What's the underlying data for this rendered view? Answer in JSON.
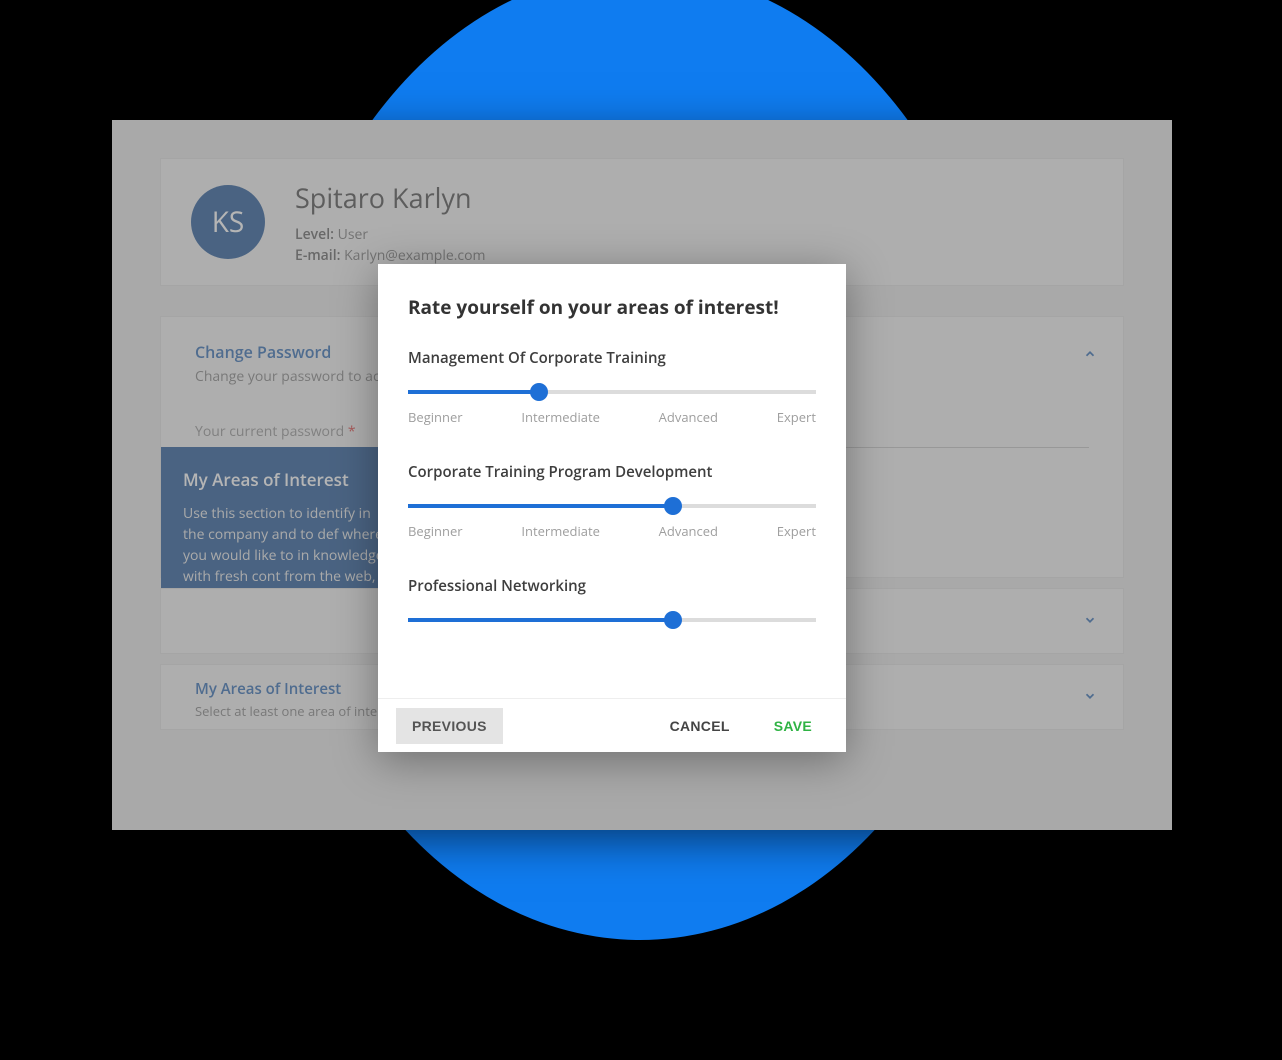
{
  "user": {
    "initials": "KS",
    "name": "Spitaro Karlyn",
    "level_label": "Level:",
    "level_value": "User",
    "email_label": "E-mail:",
    "email_value": "Karlyn@example.com"
  },
  "password_section": {
    "title": "Change Password",
    "subtitle": "Change your password to access",
    "current_label": "Your current password",
    "required_mark": "*"
  },
  "tooltip": {
    "title": "My Areas of Interest",
    "body": "Use this section to identify in the company and to def where you would like to in knowledge with fresh cont from the web, prepared fo day."
  },
  "rows": [
    {
      "title": "",
      "sub": ""
    },
    {
      "title": "My Areas of Interest",
      "sub": "Select at least one area of interest"
    }
  ],
  "modal": {
    "title": "Rate yourself on your areas of interest!",
    "ticks": [
      "Beginner",
      "Intermediate",
      "Advanced",
      "Expert"
    ],
    "ratings": [
      {
        "label": "Management Of Corporate Training",
        "value_pct": 32
      },
      {
        "label": "Corporate Training Program Development",
        "value_pct": 65
      },
      {
        "label": "Professional Networking",
        "value_pct": 65
      }
    ],
    "buttons": {
      "previous": "PREVIOUS",
      "cancel": "CANCEL",
      "save": "SAVE"
    }
  }
}
